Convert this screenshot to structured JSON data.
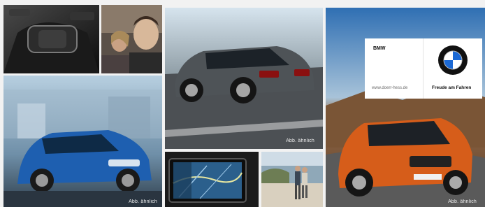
{
  "brand": {
    "name": "BMW",
    "url": "www.doerr-hess.de",
    "slogan": "Freude am Fahren"
  },
  "captions": {
    "tile_wagon": "Abb. ähnlich",
    "tile_blue": "Abb. ähnlich",
    "tile_x1": "Abb. ähnlich"
  }
}
